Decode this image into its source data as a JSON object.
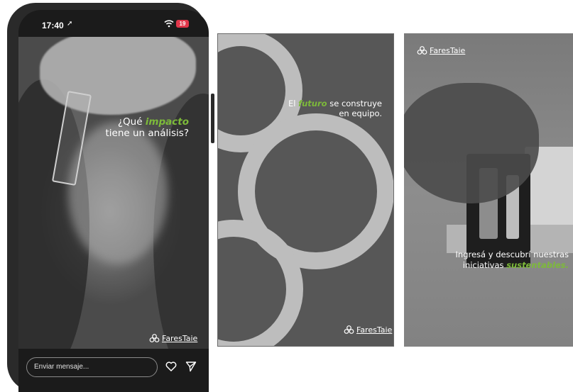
{
  "phone": {
    "status": {
      "time": "17:40",
      "battery": "19"
    },
    "story": {
      "text_line1_prefix": "¿Qué ",
      "text_line1_highlight": "impacto",
      "text_line2": "tiene un análisis?",
      "logo": "FaresTaie"
    },
    "message_bar": {
      "placeholder": "Enviar mensaje..."
    }
  },
  "panel2": {
    "text_line1_prefix": "El ",
    "text_line1_highlight": "futuro",
    "text_line1_suffix": " se construye",
    "text_line2": "en equipo.",
    "logo": "FaresTaie"
  },
  "panel3": {
    "logo": "FaresTaie",
    "text_line1": "Ingresá y descubrí nuestras",
    "text_line2_prefix": "iniciativas ",
    "text_line2_highlight": "sustentables."
  },
  "colors": {
    "accent_green": "#7dba3a",
    "phone_frame": "#2a2a2a",
    "panel_dark": "#575757",
    "ring_light": "#bdbdbd"
  }
}
